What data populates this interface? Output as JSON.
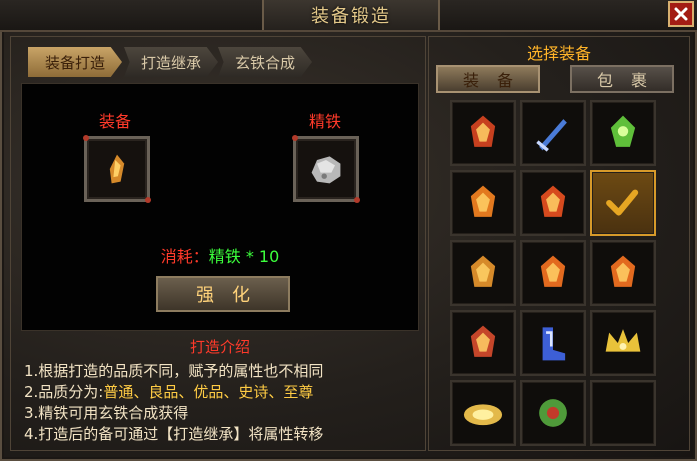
{
  "window": {
    "title": "装备锻造",
    "close_icon": "close-icon"
  },
  "tabs": [
    "装备打造",
    "打造继承",
    "玄铁合成"
  ],
  "forge": {
    "equip_label": "装备",
    "material_label": "精铁",
    "cost_label": "消耗：",
    "cost_value": "精铁 * 10",
    "strengthen_button": "强化"
  },
  "intro": {
    "title": "打造介绍",
    "line1": "1.根据打造的品质不同，赋予的属性也不相同",
    "line2_prefix": "2.品质分为:",
    "line2_values": "普通、良品、优品、史诗、至尊",
    "line3": "3.精铁可用玄铁合成获得",
    "line4": "4.打造后的备可通过【打造继承】将属性转移"
  },
  "select_panel": {
    "title": "选择装备",
    "equip_button": "装备",
    "bag_button": "包裹",
    "items": [
      {
        "icon": "red-armor-icon",
        "color": "#c7401f"
      },
      {
        "icon": "blue-sword-icon",
        "color": "#4a7bd8"
      },
      {
        "icon": "green-charm-icon",
        "color": "#5fbf3a"
      },
      {
        "icon": "fire-helmet-icon",
        "color": "#e2791f"
      },
      {
        "icon": "fire-armor-icon",
        "color": "#d64a1e"
      },
      {
        "icon": "check-icon",
        "color": "#e6a623",
        "selected": true
      },
      {
        "icon": "gold-bracer-icon",
        "color": "#d68a2a"
      },
      {
        "icon": "fire-ring-icon",
        "color": "#e26a1f"
      },
      {
        "icon": "fire-ring-icon",
        "color": "#e26a1f"
      },
      {
        "icon": "red-gauntlet-icon",
        "color": "#c5462a"
      },
      {
        "icon": "blue-boots-icon",
        "color": "#3d5fd6"
      },
      {
        "icon": "gold-crown-icon",
        "color": "#e9c23a"
      },
      {
        "icon": "gold-medal-icon",
        "color": "#e3b94a"
      },
      {
        "icon": "green-amulet-icon",
        "color": "#4f9a3a"
      },
      {
        "icon": "empty",
        "color": ""
      }
    ]
  }
}
